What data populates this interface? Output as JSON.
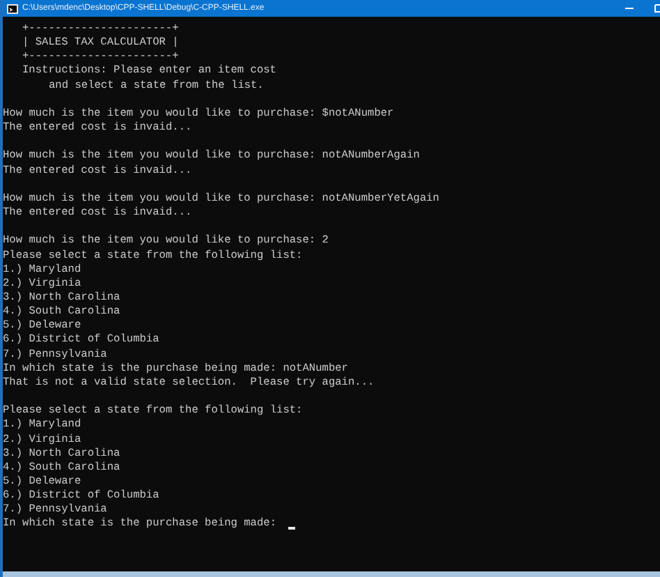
{
  "window": {
    "title": "C:\\Users\\mdenc\\Desktop\\CPP-SHELL\\Debug\\C-CPP-SHELL.exe"
  },
  "console": {
    "cursor_visible": true,
    "lines": [
      {
        "kind": "banner",
        "text": "+----------------------+"
      },
      {
        "kind": "banner",
        "text": "| SALES TAX CALCULATOR |"
      },
      {
        "kind": "banner",
        "text": "+----------------------+"
      },
      {
        "kind": "banner",
        "text": "Instructions: Please enter an item cost"
      },
      {
        "kind": "continuation",
        "text": "and select a state from the list."
      },
      {
        "kind": "blank"
      },
      {
        "kind": "text",
        "text": "How much is the item you would like to purchase: $notANumber"
      },
      {
        "kind": "text",
        "text": "The entered cost is invaid..."
      },
      {
        "kind": "blank"
      },
      {
        "kind": "text",
        "text": "How much is the item you would like to purchase: notANumberAgain"
      },
      {
        "kind": "text",
        "text": "The entered cost is invaid..."
      },
      {
        "kind": "blank"
      },
      {
        "kind": "text",
        "text": "How much is the item you would like to purchase: notANumberYetAgain"
      },
      {
        "kind": "text",
        "text": "The entered cost is invaid..."
      },
      {
        "kind": "blank"
      },
      {
        "kind": "text",
        "text": "How much is the item you would like to purchase: 2"
      },
      {
        "kind": "text",
        "text": "Please select a state from the following list:"
      },
      {
        "kind": "text",
        "text": "1.) Maryland"
      },
      {
        "kind": "text",
        "text": "2.) Virginia"
      },
      {
        "kind": "text",
        "text": "3.) North Carolina"
      },
      {
        "kind": "text",
        "text": "4.) South Carolina"
      },
      {
        "kind": "text",
        "text": "5.) Deleware"
      },
      {
        "kind": "text",
        "text": "6.) District of Columbia"
      },
      {
        "kind": "text",
        "text": "7.) Pennsylvania"
      },
      {
        "kind": "text",
        "text": "In which state is the purchase being made: notANumber"
      },
      {
        "kind": "text",
        "text": "That is not a valid state selection.  Please try again..."
      },
      {
        "kind": "blank"
      },
      {
        "kind": "text",
        "text": "Please select a state from the following list:"
      },
      {
        "kind": "text",
        "text": "1.) Maryland"
      },
      {
        "kind": "text",
        "text": "2.) Virginia"
      },
      {
        "kind": "text",
        "text": "3.) North Carolina"
      },
      {
        "kind": "text",
        "text": "4.) South Carolina"
      },
      {
        "kind": "text",
        "text": "5.) Deleware"
      },
      {
        "kind": "text",
        "text": "6.) District of Columbia"
      },
      {
        "kind": "text",
        "text": "7.) Pennsylvania"
      },
      {
        "kind": "text",
        "text": "In which state is the purchase being made: "
      }
    ]
  }
}
